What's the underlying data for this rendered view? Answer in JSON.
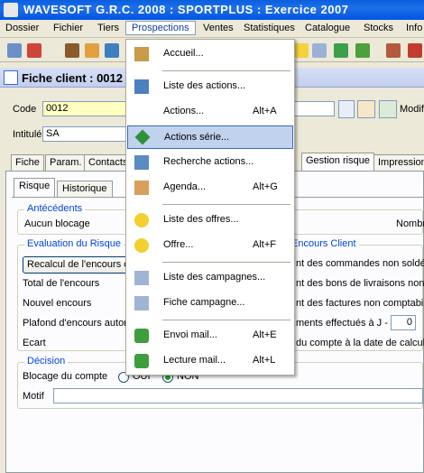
{
  "app": {
    "title": "WAVESOFT G.R.C. 2008 : SPORTPLUS : Exercice 2007"
  },
  "menubar": [
    "Dossier",
    "Fichier",
    "Tiers",
    "Prospections",
    "Ventes",
    "Statistiques",
    "Catalogue",
    "Stocks",
    "Info"
  ],
  "colors": {
    "title_bar": "#0054E3",
    "menu_highlight": "#C1D2EE",
    "group_title": "#0046D5"
  },
  "toolbar_icons": [
    "edit-icon",
    "delete-icon",
    "people-icon",
    "handshake-icon",
    "user-icon",
    "star-icon",
    "document-icon",
    "globe-icon",
    "save-icon",
    "grid-icon",
    "exit-icon"
  ],
  "window": {
    "title": "Fiche client : 0012"
  },
  "form": {
    "code_label": "Code",
    "code_value": "0012",
    "intitule_label": "Intitulé",
    "intitule_value": "SA",
    "modif_label": "Modifi"
  },
  "tabs": [
    "Fiche",
    "Param.",
    "Contacts",
    "Gestion risque",
    "Impression"
  ],
  "subtabs": [
    "Risque",
    "Historique"
  ],
  "antecedents": {
    "title": "Antécédents",
    "text": "Aucun blocage",
    "right": "Nombr"
  },
  "evaluation": {
    "title": "Evaluation du Risque",
    "button": "Recalcul de l'encours c",
    "rows": [
      "Total de l'encours",
      "Nouvel encours",
      "Plafond d'encours autori",
      "Ecart"
    ]
  },
  "encours_client": {
    "title": "Encours Client",
    "rows": [
      "nt des commandes non soldées",
      "nt des bons de livraisons non so",
      "nt des factures non comptabili",
      "ments effectués à J -",
      "du compte à la date de calcul"
    ],
    "days_value": "0"
  },
  "decision": {
    "title": "Décision",
    "blocage_label": "Blocage du compte",
    "oui": "OUI",
    "non": "NON",
    "motif_label": "Motif"
  },
  "dropdown": {
    "items": [
      {
        "label": "Accueil...",
        "shortcut": "",
        "icon": "home-icon"
      },
      {
        "label": "Liste des actions...",
        "shortcut": "",
        "icon": "actions-list-icon"
      },
      {
        "label": "Actions...",
        "shortcut": "Alt+A",
        "icon": ""
      },
      {
        "label": "Actions série...",
        "shortcut": "",
        "icon": "series-icon"
      },
      {
        "label": "Recherche actions...",
        "shortcut": "",
        "icon": "search-actions-icon"
      },
      {
        "label": "Agenda...",
        "shortcut": "Alt+G",
        "icon": "agenda-icon"
      },
      {
        "label": "Liste des offres...",
        "shortcut": "",
        "icon": "offers-list-icon"
      },
      {
        "label": "Offre...",
        "shortcut": "Alt+F",
        "icon": "offer-icon"
      },
      {
        "label": "Liste des campagnes...",
        "shortcut": "",
        "icon": "campaigns-list-icon"
      },
      {
        "label": "Fiche campagne...",
        "shortcut": "",
        "icon": "campaign-icon"
      },
      {
        "label": "Envoi mail...",
        "shortcut": "Alt+E",
        "icon": "send-mail-icon"
      },
      {
        "label": "Lecture mail...",
        "shortcut": "Alt+L",
        "icon": "read-mail-icon"
      }
    ]
  }
}
